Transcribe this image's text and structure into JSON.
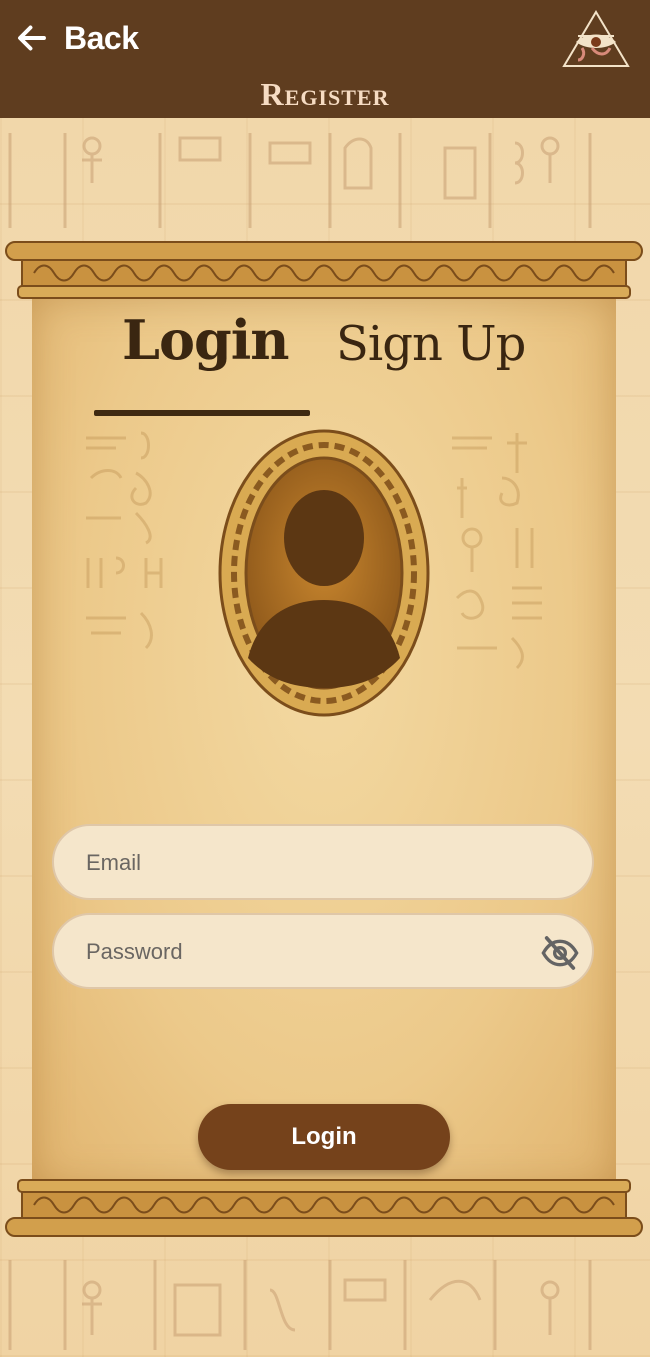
{
  "header": {
    "back_label": "Back",
    "title": "Register"
  },
  "tabs": [
    {
      "label": "Login",
      "active": true
    },
    {
      "label": "Sign Up",
      "active": false
    }
  ],
  "form": {
    "email": {
      "placeholder": "Email",
      "value": ""
    },
    "password": {
      "placeholder": "Password",
      "value": ""
    },
    "submit_label": "Login"
  },
  "icons": {
    "back": "arrow-left-icon",
    "logo": "eye-of-ra-logo",
    "avatar": "user-silhouette-icon",
    "password_toggle": "eye-off-icon"
  },
  "colors": {
    "header_bg": "#5f3d1f",
    "title": "#f6dcc3",
    "button_bg": "#75421b",
    "tab_text": "#3a2611",
    "input_bg": "#f5e6cb"
  }
}
